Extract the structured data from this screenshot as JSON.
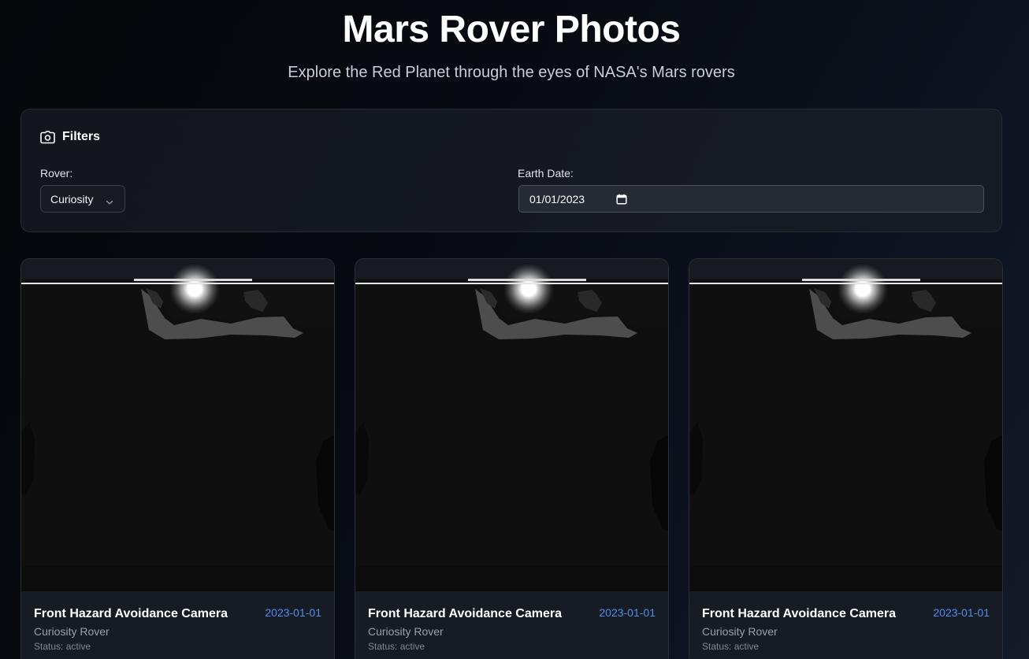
{
  "header": {
    "title": "Mars Rover Photos",
    "subtitle": "Explore the Red Planet through the eyes of NASA's Mars rovers"
  },
  "filters": {
    "title": "Filters",
    "icon": "camera-icon",
    "rover_label": "Rover:",
    "rover_value": "Curiosity",
    "date_label": "Earth Date:",
    "date_value": "01/01/2023"
  },
  "photos": [
    {
      "camera": "Front Hazard Avoidance Camera",
      "date": "2023-01-01",
      "rover": "Curiosity Rover",
      "status": "Status: active"
    },
    {
      "camera": "Front Hazard Avoidance Camera",
      "date": "2023-01-01",
      "rover": "Curiosity Rover",
      "status": "Status: active"
    },
    {
      "camera": "Front Hazard Avoidance Camera",
      "date": "2023-01-01",
      "rover": "Curiosity Rover",
      "status": "Status: active"
    }
  ],
  "colors": {
    "accent": "#4c8ff2",
    "background": "#080b12",
    "panel": "#161a22"
  }
}
